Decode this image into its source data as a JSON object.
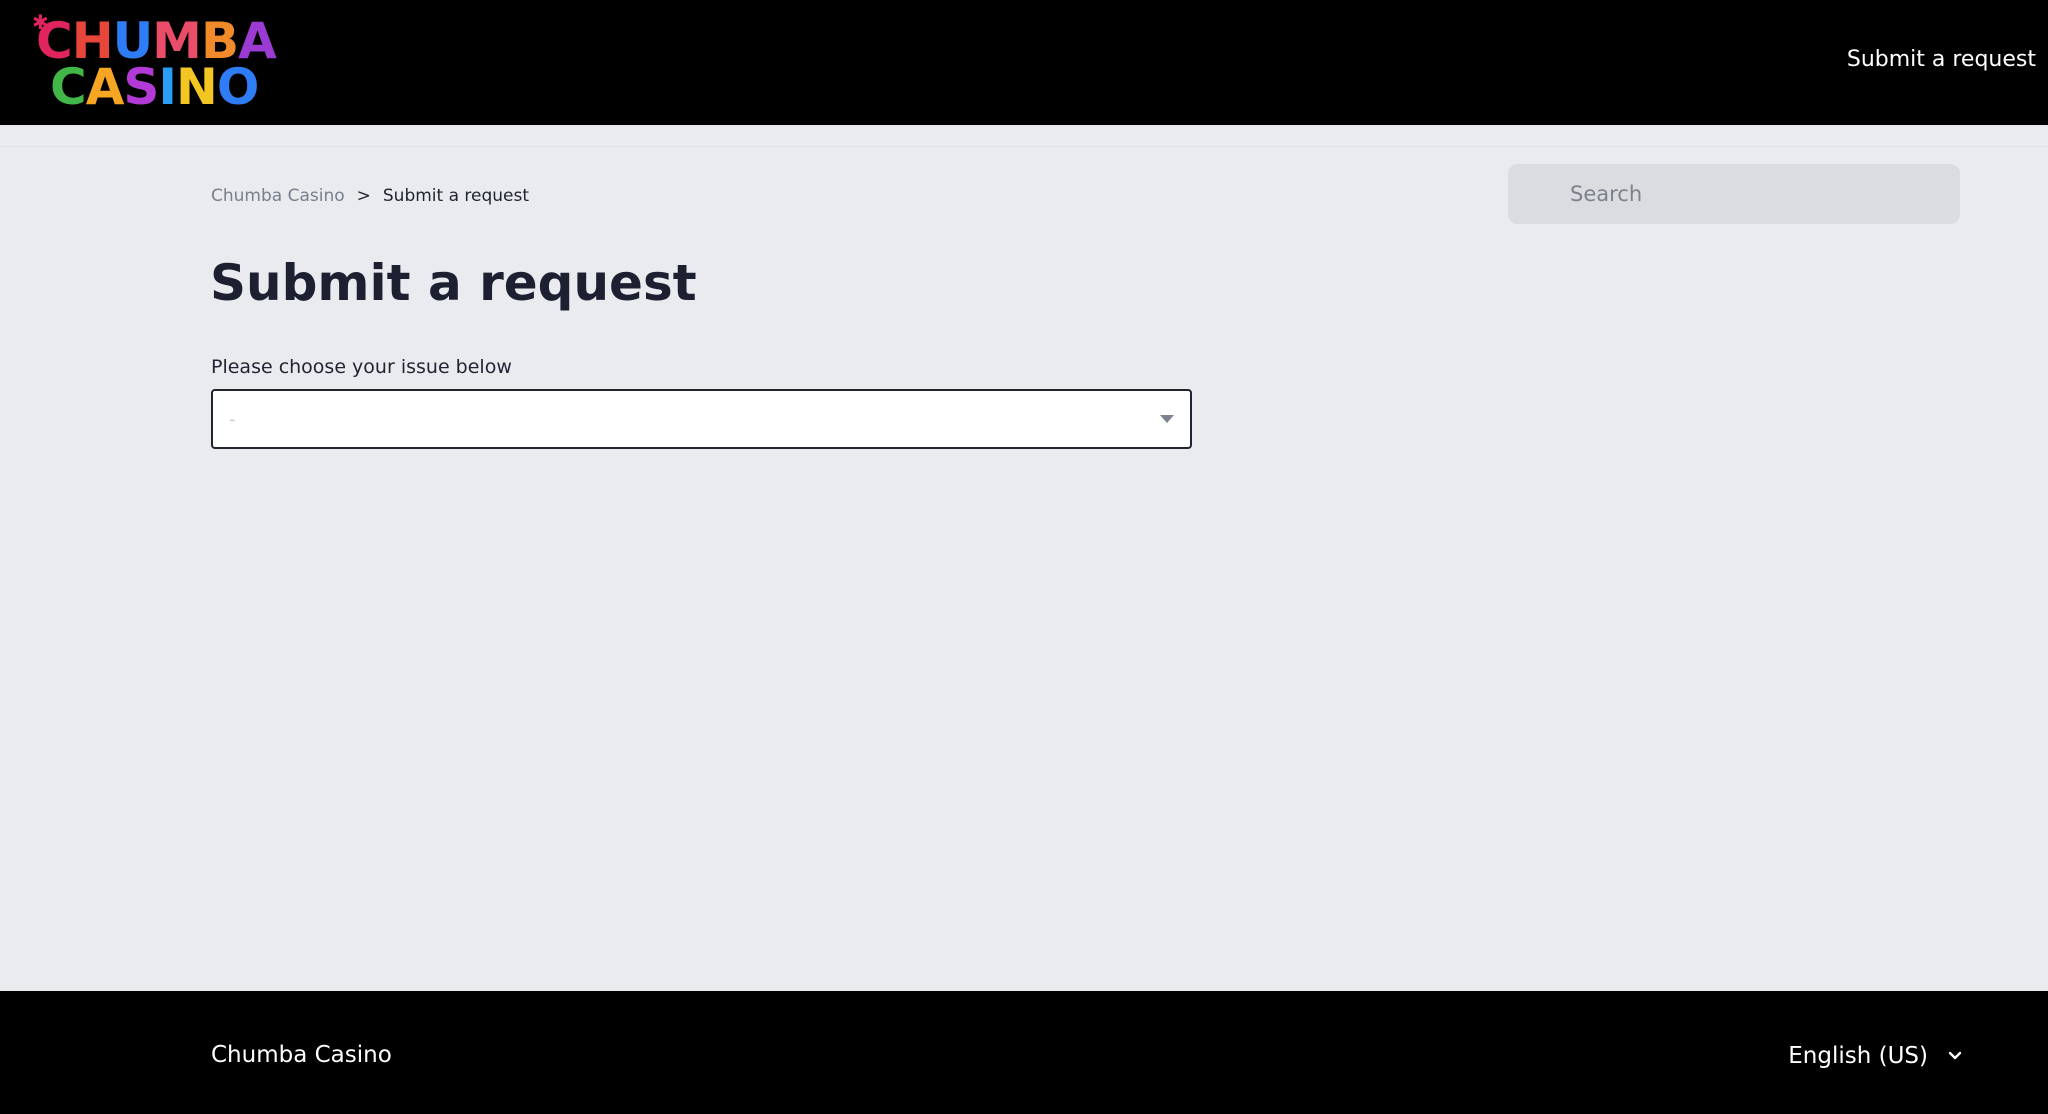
{
  "header": {
    "logo": {
      "line1": [
        {
          "char": "C",
          "color": "#e0245e"
        },
        {
          "char": "H",
          "color": "#e8463a"
        },
        {
          "char": "U",
          "color": "#2f7df6"
        },
        {
          "char": "M",
          "color": "#e94d6a"
        },
        {
          "char": "B",
          "color": "#f08a2b"
        },
        {
          "char": "A",
          "color": "#9b3bd4"
        }
      ],
      "line2": [
        {
          "char": "C",
          "color": "#43b649"
        },
        {
          "char": "A",
          "color": "#f6a623"
        },
        {
          "char": "S",
          "color": "#b43ad8"
        },
        {
          "char": "I",
          "color": "#2a9df4"
        },
        {
          "char": "N",
          "color": "#f3c623"
        },
        {
          "char": "O",
          "color": "#2f7df6"
        }
      ],
      "star_color": "#e0245e"
    },
    "nav_link": "Submit a request"
  },
  "breadcrumb": {
    "home": "Chumba Casino",
    "separator": ">",
    "current": "Submit a request"
  },
  "search": {
    "placeholder": "Search",
    "icon": "search-icon"
  },
  "main": {
    "title": "Submit a request",
    "issue_label": "Please choose your issue below",
    "issue_select": {
      "value": "-",
      "icon": "caret-down-icon"
    }
  },
  "footer": {
    "brand": "Chumba Casino",
    "language": "English (US)",
    "language_icon": "chevron-down-icon"
  },
  "colors": {
    "header_bg": "#000000",
    "page_bg": "#e9ebef",
    "text_dark": "#1c2030",
    "search_bg": "#dadce0"
  }
}
